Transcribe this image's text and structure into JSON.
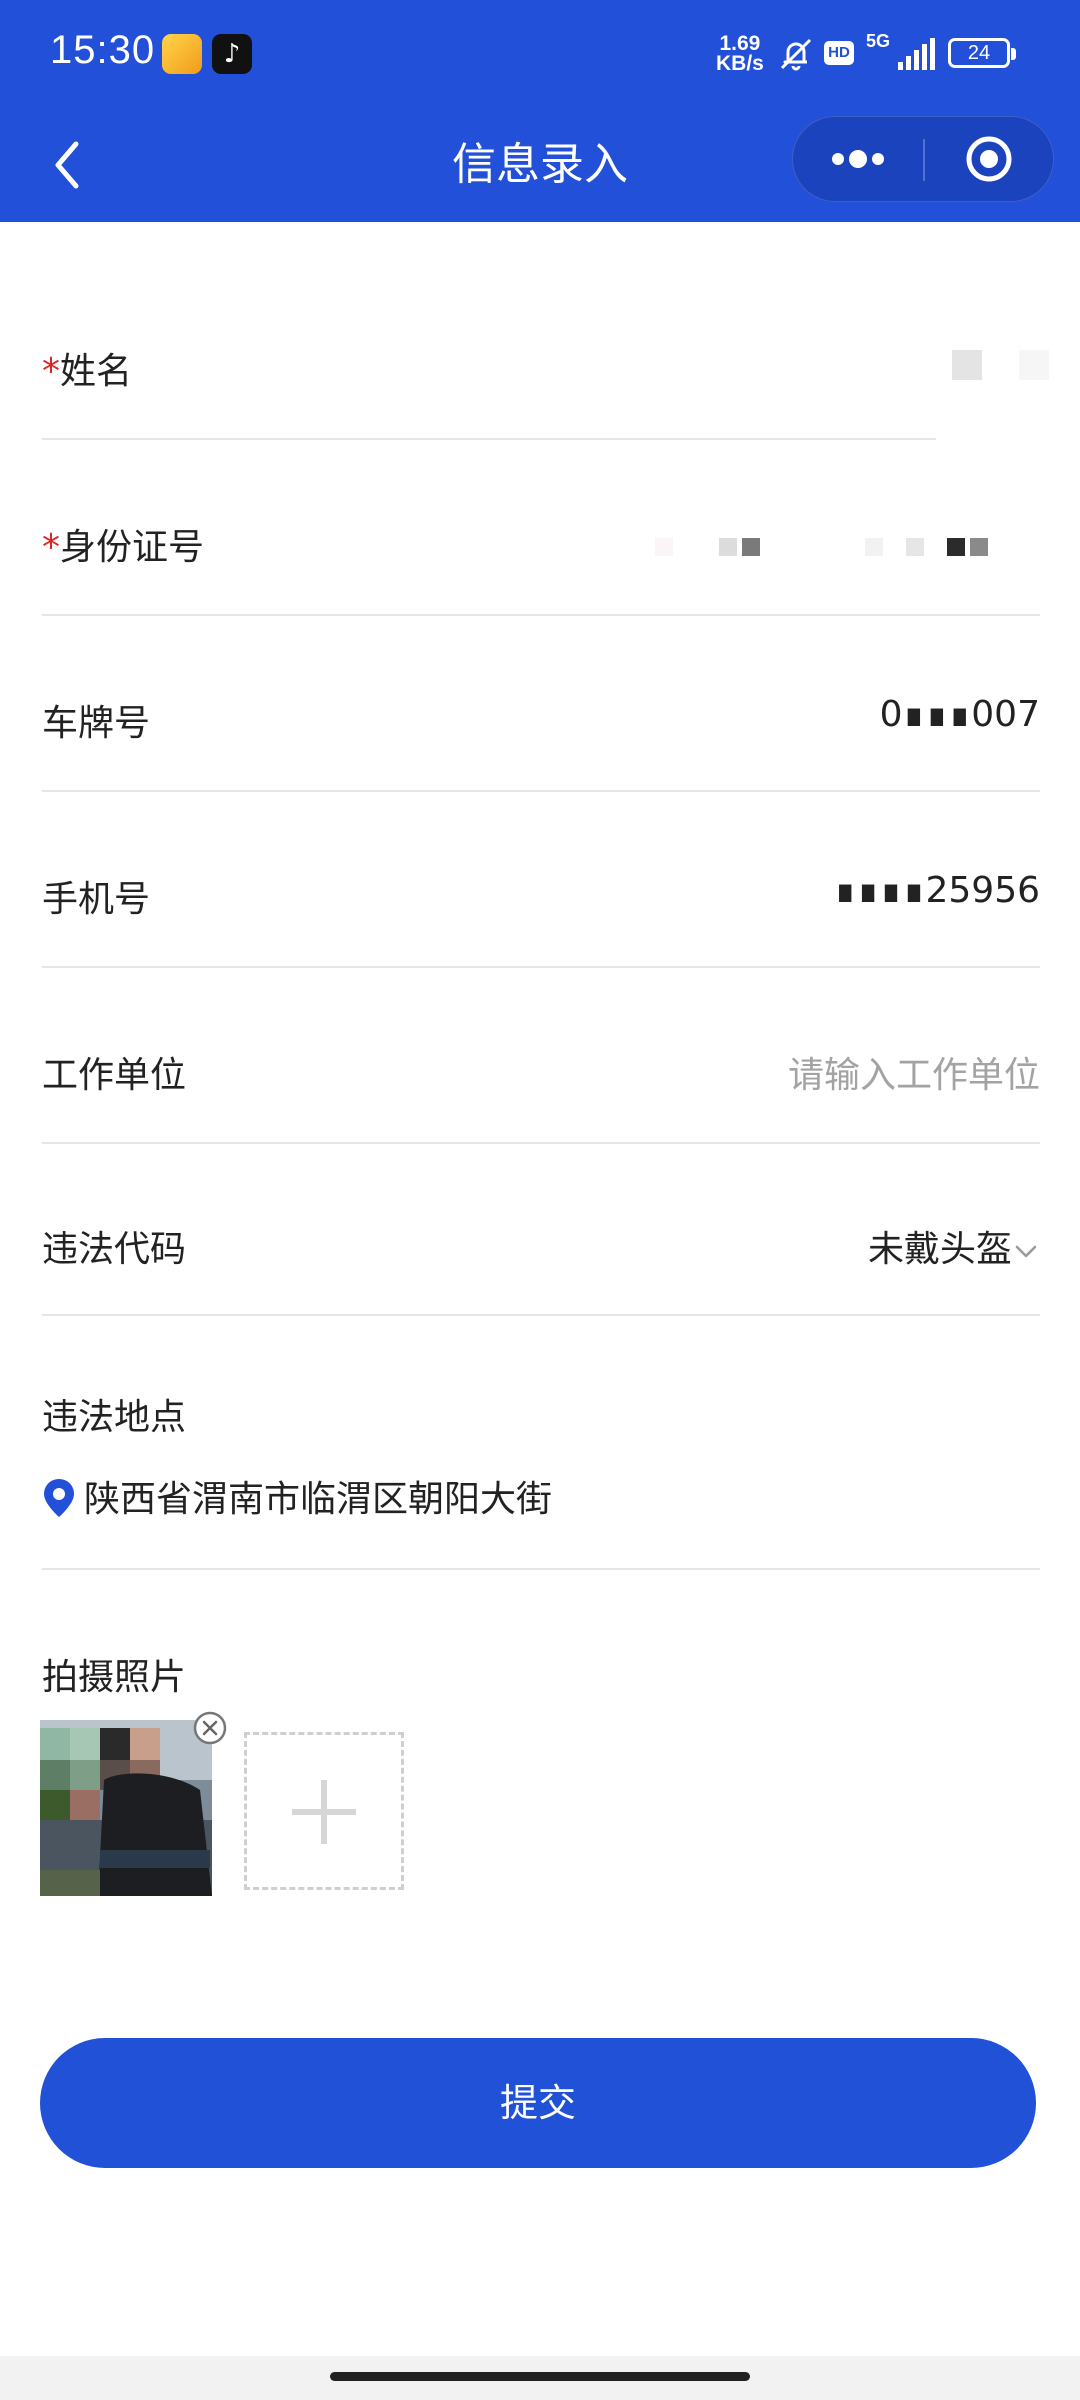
{
  "status_bar": {
    "time": "15:30",
    "net_speed_value": "1.69",
    "net_speed_unit": "KB/s",
    "hd_label": "HD",
    "network_label": "5G",
    "battery_level": "24",
    "app_icons": [
      "notes-app-icon",
      "tiktok-icon"
    ]
  },
  "nav": {
    "title": "信息录入",
    "back_icon": "chevron-left-icon",
    "more_icon": "more-dots-icon",
    "close_icon": "target-circle-icon"
  },
  "form": {
    "name": {
      "required_mark": "*",
      "label": "姓名",
      "value": ""
    },
    "id_number": {
      "required_mark": "*",
      "label": "身份证号",
      "value": ""
    },
    "plate": {
      "label": "车牌号",
      "value": "0∎∎∎007"
    },
    "phone": {
      "label": "手机号",
      "value": "∎∎∎∎25956"
    },
    "workplace": {
      "label": "工作单位",
      "placeholder": "请输入工作单位",
      "value": ""
    },
    "violation_code": {
      "label": "违法代码",
      "selected": "未戴头盔"
    },
    "violation_location": {
      "label": "违法地点",
      "address": "陕西省渭南市临渭区朝阳大街"
    },
    "photos": {
      "label": "拍摄照片"
    }
  },
  "submit": {
    "label": "提交"
  },
  "colors": {
    "brand_blue": "#2350d8",
    "required_red": "#e02424",
    "placeholder_gray": "#a3a3a3"
  }
}
